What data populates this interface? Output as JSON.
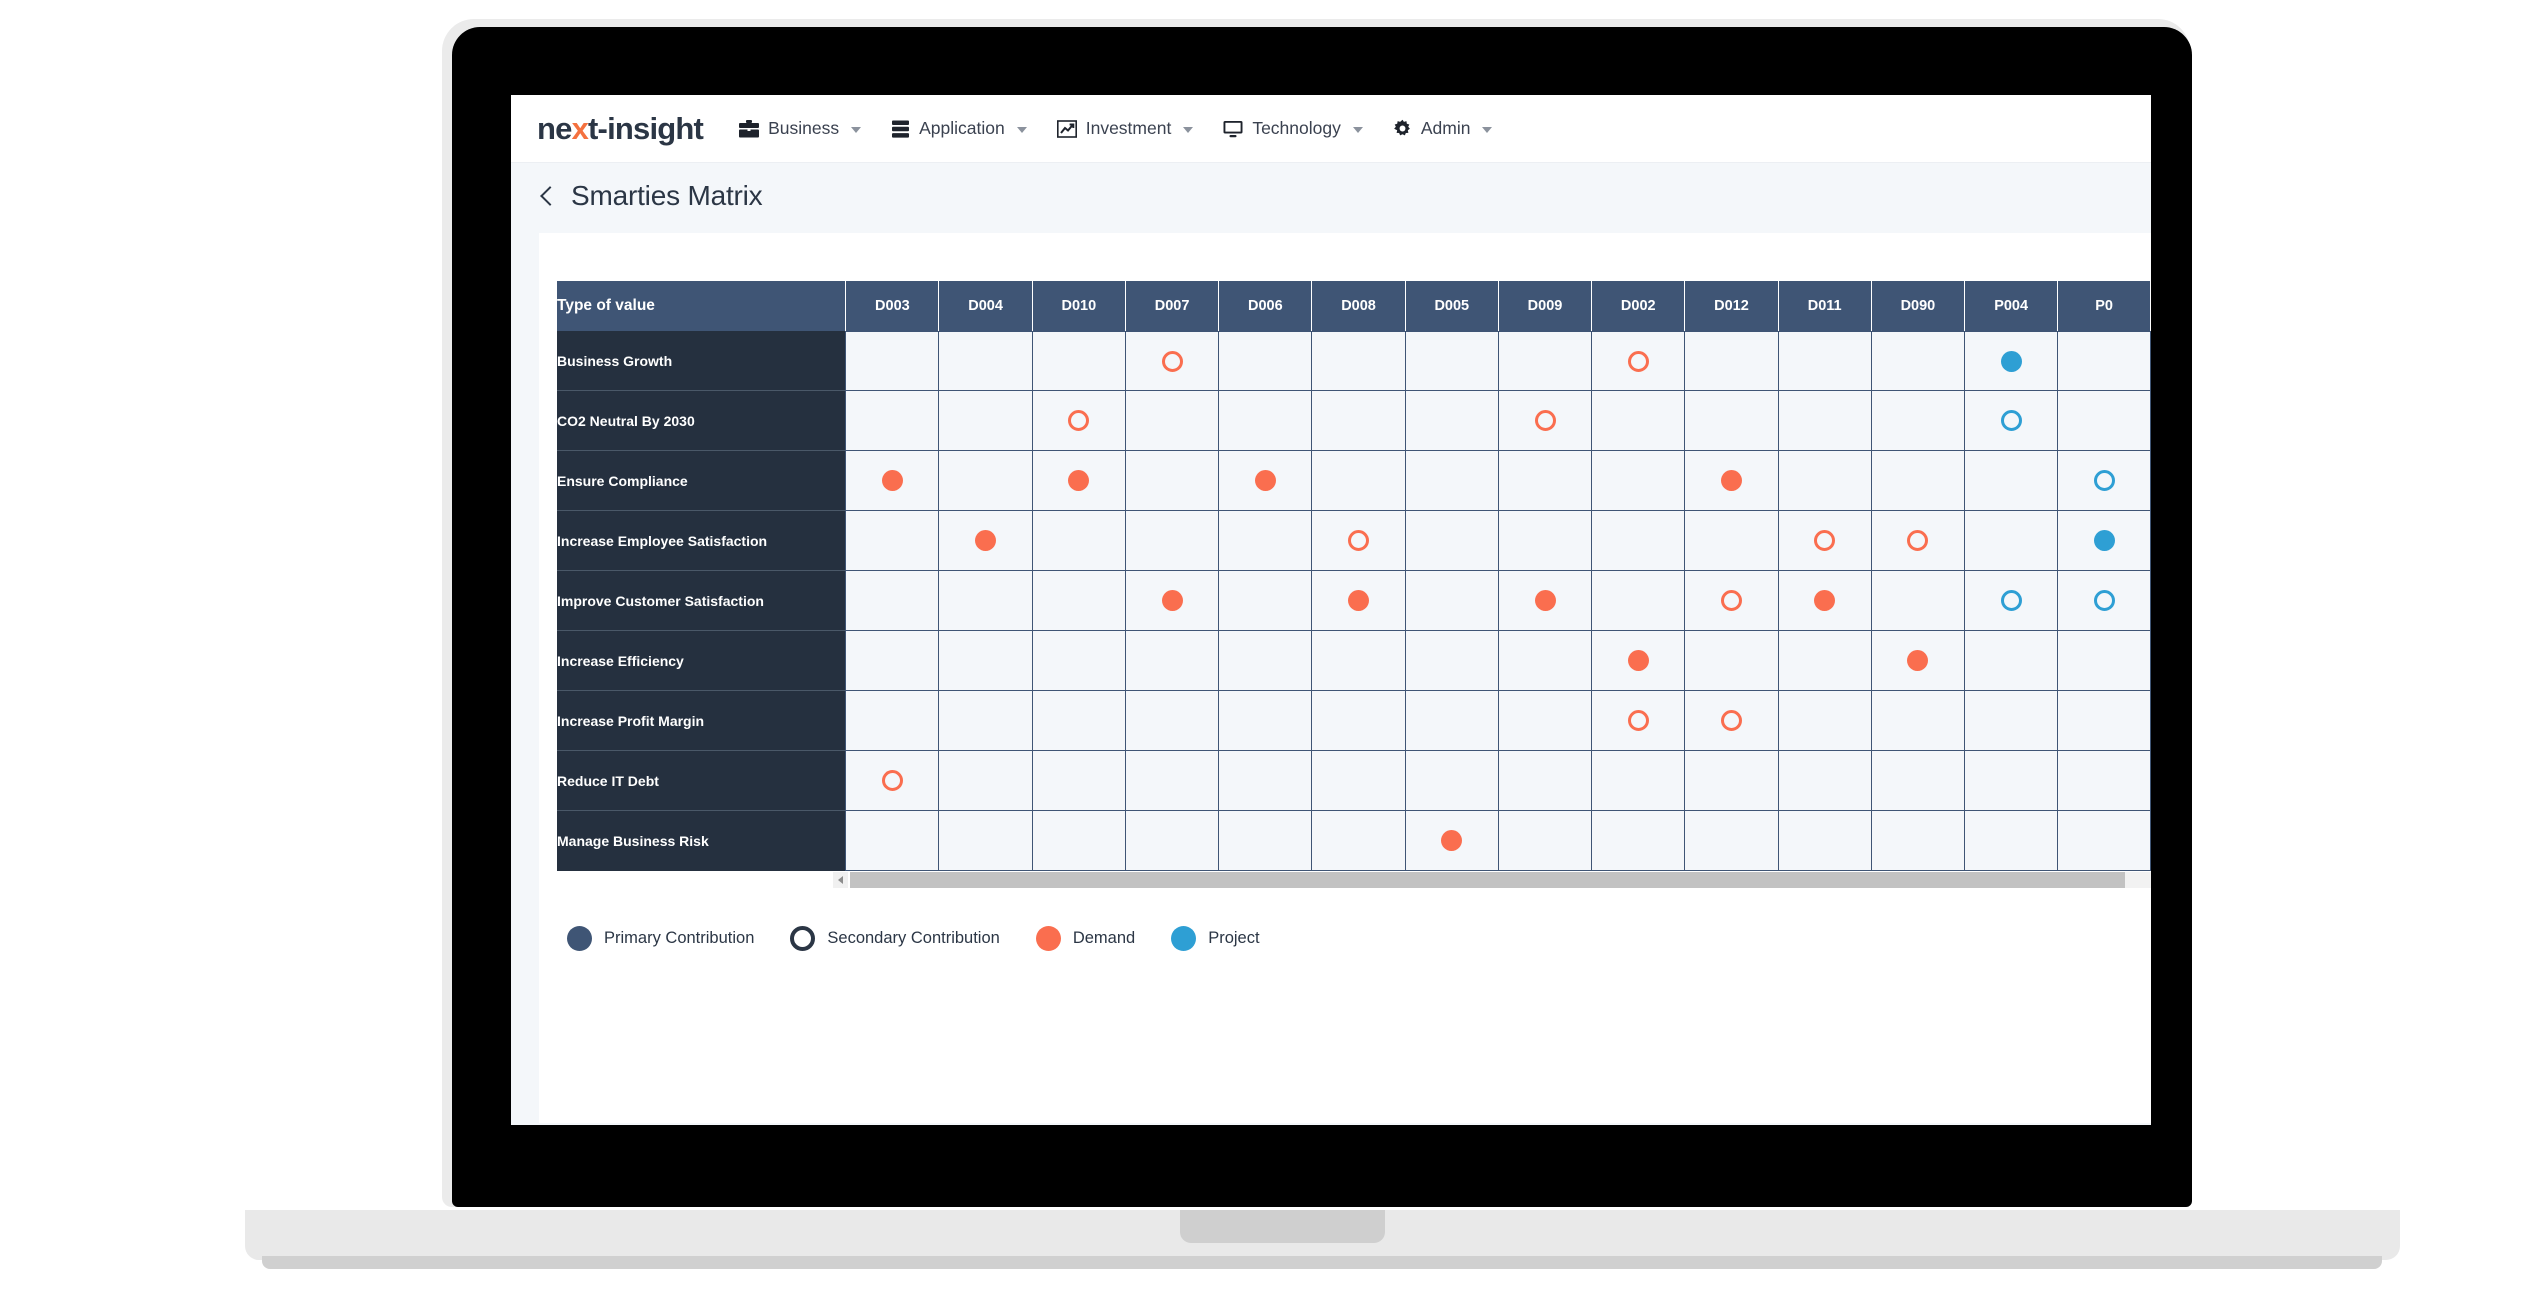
{
  "navbar": {
    "brand_prefix": "ne",
    "brand_accent": "x",
    "brand_suffix": "t-insight",
    "items": [
      {
        "label": "Business",
        "icon": "briefcase-icon"
      },
      {
        "label": "Application",
        "icon": "server-icon"
      },
      {
        "label": "Investment",
        "icon": "chart-line-icon"
      },
      {
        "label": "Technology",
        "icon": "monitor-icon"
      },
      {
        "label": "Admin",
        "icon": "gear-icon"
      }
    ]
  },
  "page": {
    "title": "Smarties Matrix",
    "back_icon": "chevron-left-icon"
  },
  "matrix": {
    "corner_header": "Type of value",
    "columns": [
      "D003",
      "D004",
      "D010",
      "D007",
      "D006",
      "D008",
      "D005",
      "D009",
      "D002",
      "D012",
      "D011",
      "D090",
      "P004",
      "P0"
    ],
    "rows": [
      {
        "label": "Business Growth",
        "cells": [
          "",
          "",
          "",
          "demand-o",
          "",
          "",
          "",
          "",
          "demand-o",
          "",
          "",
          "",
          "project-f",
          ""
        ]
      },
      {
        "label": "CO2 Neutral By 2030",
        "cells": [
          "",
          "",
          "demand-o",
          "",
          "",
          "",
          "",
          "demand-o",
          "",
          "",
          "",
          "",
          "project-o",
          ""
        ]
      },
      {
        "label": "Ensure Compliance",
        "cells": [
          "demand-f",
          "",
          "demand-f",
          "",
          "demand-f",
          "",
          "",
          "",
          "",
          "demand-f",
          "",
          "",
          "",
          "project-o"
        ]
      },
      {
        "label": "Increase Employee Satisfaction",
        "cells": [
          "",
          "demand-f",
          "",
          "",
          "",
          "demand-o",
          "",
          "",
          "",
          "",
          "demand-o",
          "demand-o",
          "",
          "project-f"
        ]
      },
      {
        "label": "Improve Customer Satisfaction",
        "cells": [
          "",
          "",
          "",
          "demand-f",
          "",
          "demand-f",
          "",
          "demand-f",
          "",
          "demand-o",
          "demand-f",
          "",
          "project-o",
          "project-o"
        ]
      },
      {
        "label": "Increase Efficiency",
        "cells": [
          "",
          "",
          "",
          "",
          "",
          "",
          "",
          "",
          "demand-f",
          "",
          "",
          "demand-f",
          "",
          ""
        ]
      },
      {
        "label": "Increase Profit Margin",
        "cells": [
          "",
          "",
          "",
          "",
          "",
          "",
          "",
          "",
          "demand-o",
          "demand-o",
          "",
          "",
          "",
          ""
        ]
      },
      {
        "label": "Reduce IT Debt",
        "cells": [
          "demand-o",
          "",
          "",
          "",
          "",
          "",
          "",
          "",
          "",
          "",
          "",
          "",
          "",
          ""
        ]
      },
      {
        "label": "Manage Business Risk",
        "cells": [
          "",
          "",
          "",
          "",
          "",
          "",
          "demand-f",
          "",
          "",
          "",
          "",
          "",
          "",
          ""
        ]
      }
    ]
  },
  "legend": [
    {
      "label": "Primary Contribution",
      "swatch": "sw-primary",
      "icon": "filled-circle-icon"
    },
    {
      "label": "Secondary Contribution",
      "swatch": "sw-secondary",
      "icon": "hollow-circle-icon"
    },
    {
      "label": "Demand",
      "swatch": "sw-demand",
      "icon": "filled-circle-icon"
    },
    {
      "label": "Project",
      "swatch": "sw-project",
      "icon": "filled-circle-icon"
    }
  ],
  "colors": {
    "header_blue": "#3f5575",
    "rowhead_dark": "#25303f",
    "demand_orange": "#fa6e4f",
    "project_blue": "#2e9fd4",
    "cell_bg": "#f4f7fa",
    "brand_accent": "#f4713f"
  },
  "scrollbar": {
    "left_arrow_icon": "caret-left-icon"
  }
}
